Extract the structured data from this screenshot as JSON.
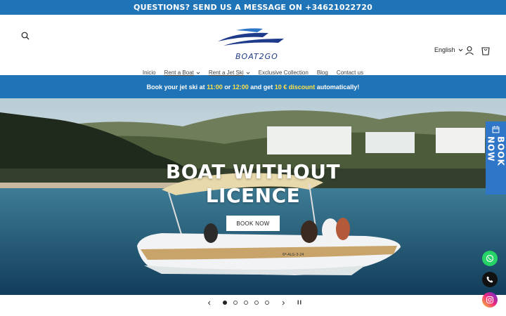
{
  "top_bar": {
    "text": "QUESTIONS? SEND US A MESSAGE ON +34621022720"
  },
  "header": {
    "logo_text": "BOAT2GO",
    "language": "English",
    "nav": [
      {
        "label": "Inicio",
        "dropdown": false
      },
      {
        "label": "Rent a Boat",
        "dropdown": true
      },
      {
        "label": "Rent a Jet Ski",
        "dropdown": true
      },
      {
        "label": "Exclusive Collection",
        "dropdown": false
      },
      {
        "label": "Blog",
        "dropdown": false
      },
      {
        "label": "Contact us",
        "dropdown": false
      }
    ]
  },
  "promo": {
    "part1": "Book your jet ski at ",
    "time1": "11:00",
    "part2": " or ",
    "time2": "12:00",
    "part3": " and get ",
    "discount": "10 € discount",
    "part4": " automatically!"
  },
  "hero": {
    "title_line1": "BOAT WITHOUT",
    "title_line2": "LICENCE",
    "cta": "BOOK NOW",
    "boat_reg": "6ª-ALG-3-24"
  },
  "side_book": {
    "label": "BOOK NOW"
  },
  "slider": {
    "slides": 5,
    "active_index": 0
  },
  "colors": {
    "brand_blue": "#1f73b7",
    "promo_highlight": "#ffe24a",
    "side_button": "#2f76c8",
    "whatsapp": "#25d366"
  },
  "icons": [
    "search-icon",
    "user-icon",
    "cart-icon",
    "calendar-icon",
    "whatsapp-icon",
    "phone-icon",
    "instagram-icon"
  ]
}
